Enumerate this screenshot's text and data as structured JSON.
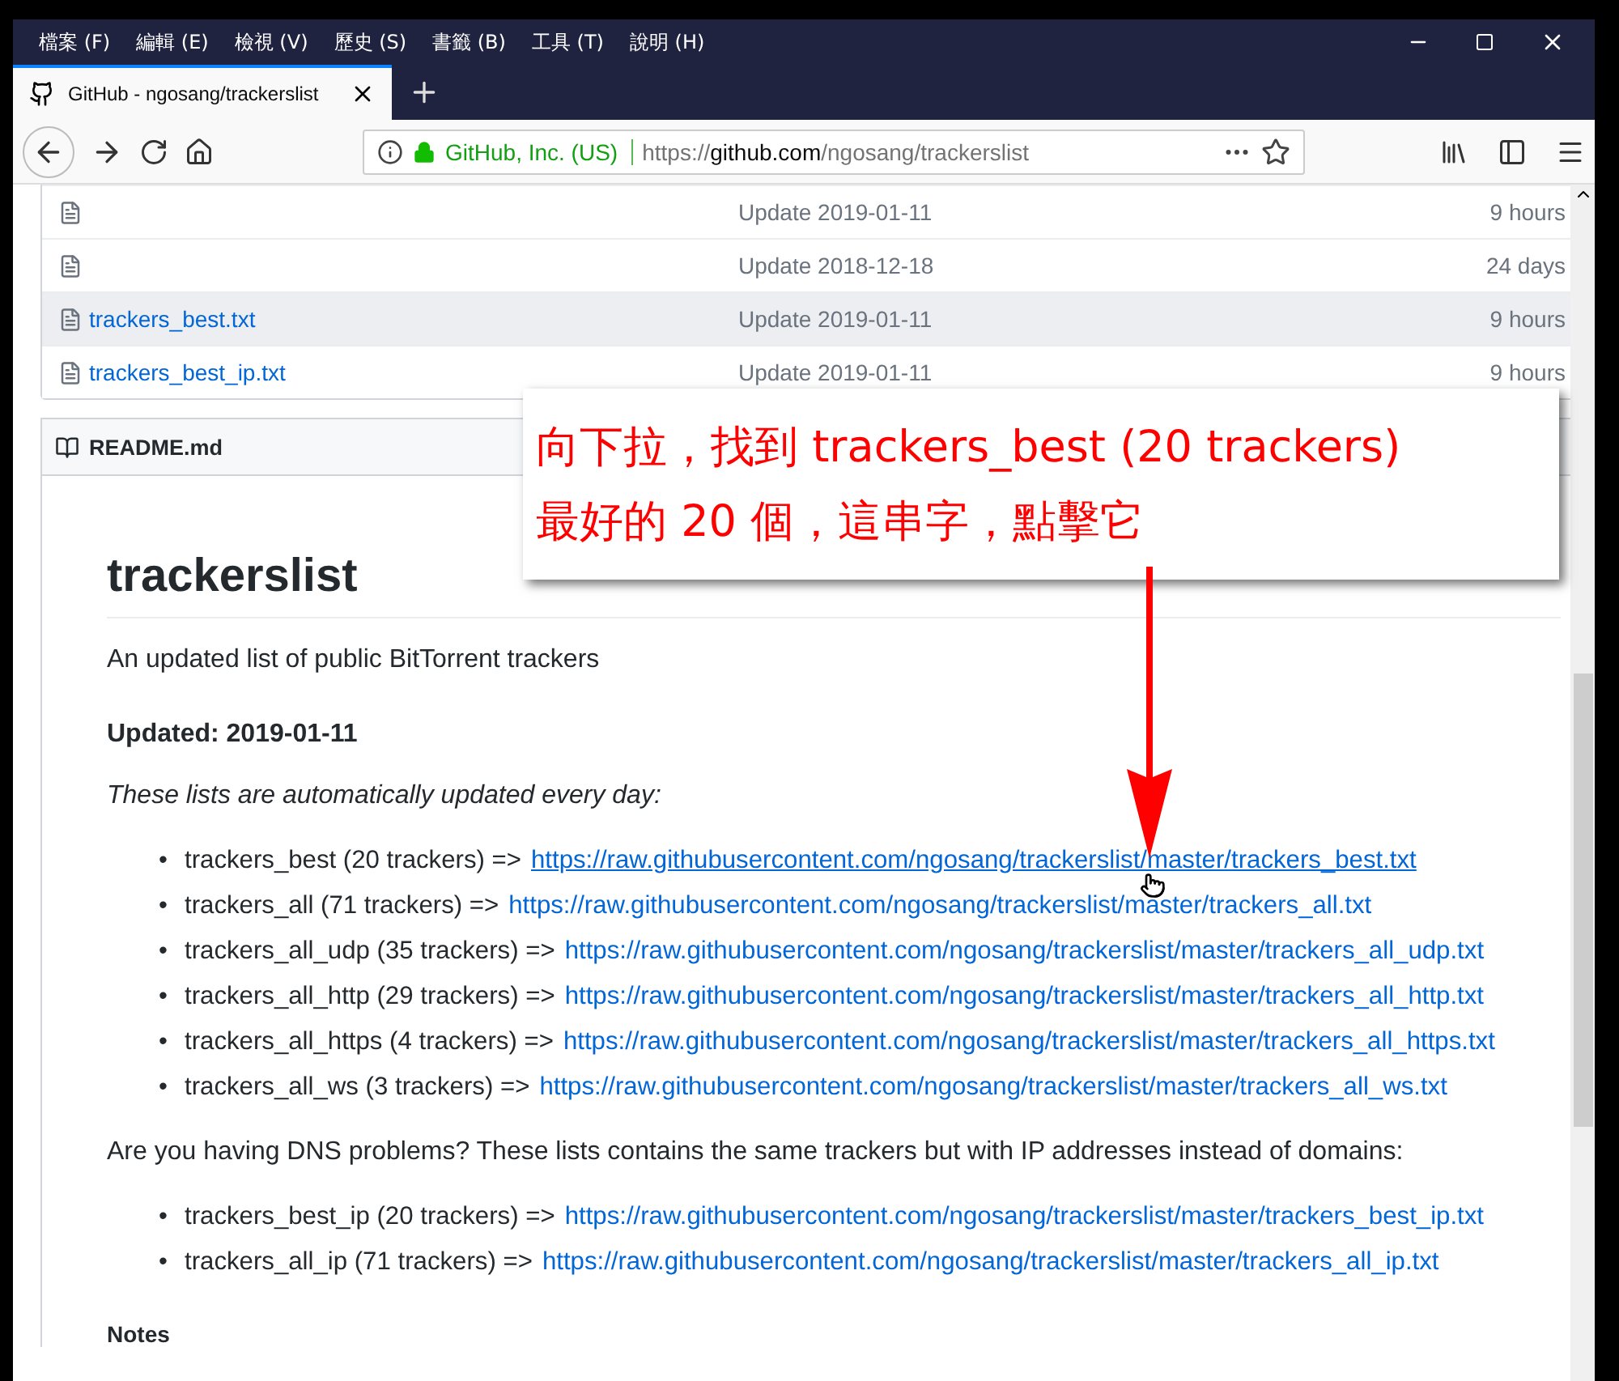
{
  "menu_bar": [
    "檔案 (F)",
    "編輯 (E)",
    "檢視 (V)",
    "歷史 (S)",
    "書籤 (B)",
    "工具 (T)",
    "說明 (H)"
  ],
  "tabs": [
    {
      "title": "GitHub - ngosang/trackerslist",
      "selected": true
    }
  ],
  "address_bar": {
    "identity": "GitHub, Inc. (US)",
    "url_prefix": "https://",
    "url_host": "github.com",
    "url_path": "/ngosang/trackerslist"
  },
  "files": [
    {
      "message": "Update 2019-01-11",
      "age": "9 hours",
      "hovered": false
    },
    {
      "message": "Update 2018-12-18",
      "age": "24 days",
      "hovered": false
    },
    {
      "name": "trackers_best.txt",
      "message": "Update 2019-01-11",
      "age": "9 hours",
      "hovered": true
    },
    {
      "name": "trackers_best_ip.txt",
      "message": "Update 2019-01-11",
      "age": "9 hours",
      "hovered": false
    }
  ],
  "readme": {
    "filename": "README.md",
    "title": "trackerslist",
    "intro": "An updated list of public BitTorrent trackers",
    "updated": "Updated: 2019-01-11",
    "note": "These lists are automatically updated every day:",
    "lists": [
      {
        "bullet": "•",
        "label": "trackers_best (20 trackers) =>",
        "url": "https://raw.githubusercontent.com/ngosang/trackerslist/master/trackers_best.txt",
        "hovered": true
      },
      {
        "bullet": "•",
        "label": "trackers_all (71 trackers) =>",
        "url": "https://raw.githubusercontent.com/ngosang/trackerslist/master/trackers_all.txt",
        "hovered": false
      },
      {
        "bullet": "•",
        "label": "trackers_all_udp (35 trackers) =>",
        "url": "https://raw.githubusercontent.com/ngosang/trackerslist/master/trackers_all_udp.txt",
        "hovered": false
      },
      {
        "bullet": "•",
        "label": "trackers_all_http (29 trackers) =>",
        "url": "https://raw.githubusercontent.com/ngosang/trackerslist/master/trackers_all_http.txt",
        "hovered": false
      },
      {
        "bullet": "•",
        "label": "trackers_all_https (4 trackers) =>",
        "url": "https://raw.githubusercontent.com/ngosang/trackerslist/master/trackers_all_https.txt",
        "hovered": false
      },
      {
        "bullet": "•",
        "label": "trackers_all_ws (3 trackers) =>",
        "url": "https://raw.githubusercontent.com/ngosang/trackerslist/master/trackers_all_ws.txt",
        "hovered": false
      }
    ],
    "dns_note": "Are you having DNS problems? These lists contains the same trackers but with IP addresses instead of domains:",
    "ip_lists": [
      {
        "bullet": "•",
        "label": "trackers_best_ip (20 trackers) =>",
        "url": "https://raw.githubusercontent.com/ngosang/trackerslist/master/trackers_best_ip.txt",
        "hovered": false
      },
      {
        "bullet": "•",
        "label": "trackers_all_ip (71 trackers) =>",
        "url": "https://raw.githubusercontent.com/ngosang/trackerslist/master/trackers_all_ip.txt",
        "hovered": false
      }
    ],
    "notes_heading": "Notes"
  },
  "callout": {
    "lines": [
      "向下拉，找到 trackers_best (20 trackers)",
      "最好的 20 個，這串字，點擊它"
    ]
  }
}
